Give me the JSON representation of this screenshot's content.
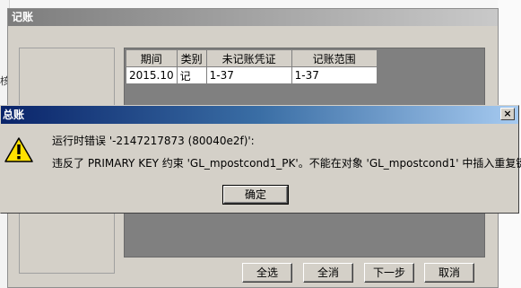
{
  "main_window": {
    "title": "记账",
    "table": {
      "headers": [
        "期间",
        "类别",
        "未记账凭证",
        "记账范围"
      ],
      "rows": [
        [
          "2015.10",
          "记",
          "1-37",
          "1-37"
        ]
      ]
    },
    "buttons": {
      "select_all": "全选",
      "deselect_all": "全消",
      "next": "下一步",
      "cancel": "取消"
    }
  },
  "dialog": {
    "title": "总账",
    "close_label": "×",
    "error_line": "运行时错误 '-2147217873 (80040e2f)':",
    "message_line": "违反了 PRIMARY KEY 约束 'GL_mpostcond1_PK'。不能在对象 'GL_mpostcond1' 中插入重复键。",
    "ok_label": "确定",
    "icon": "warning-icon"
  },
  "background": {
    "left_fragment": "核"
  }
}
